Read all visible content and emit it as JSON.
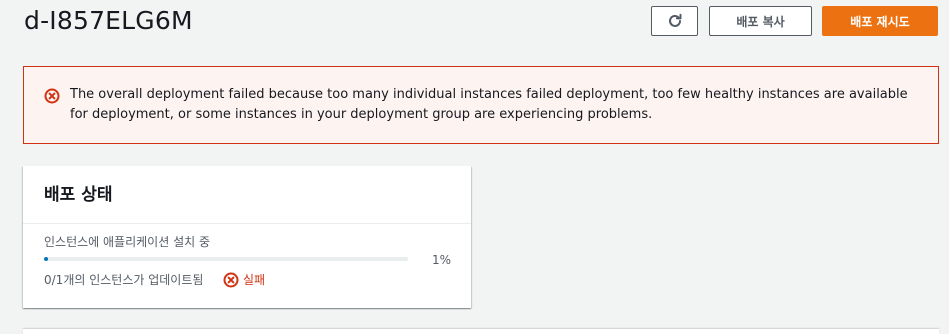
{
  "header": {
    "deployment_id": "d-I857ELG6M"
  },
  "toolbar": {
    "refresh_icon": "refresh-icon",
    "copy_label": "배포 복사",
    "retry_label": "배포 재시도"
  },
  "alert": {
    "icon": "error-circle-icon",
    "message": "The overall deployment failed because too many individual instances failed deployment, too few healthy instances are available for deployment, or some instances in your deployment group are experiencing problems."
  },
  "status_card": {
    "title": "배포 상태",
    "progress_label": "인스턴스에 애플리케이션 설치 중",
    "progress_value": 0.01,
    "progress_percent_text": "1%",
    "instances_text": "0/1개의 인스턴스가 업데이트됨",
    "status_icon": "error-circle-icon",
    "status_text": "실패"
  },
  "colors": {
    "accent": "#ec7211",
    "error": "#d13212",
    "progress": "#0073bb"
  }
}
